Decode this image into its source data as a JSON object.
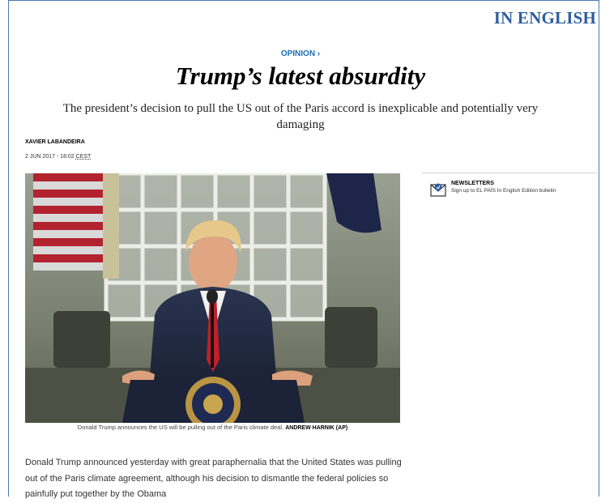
{
  "header": {
    "edition_label": "IN ENGLISH"
  },
  "article": {
    "section": "OPINION ›",
    "headline": "Trump’s latest absurdity",
    "subheadline": "The president’s decision to pull the US out of the Paris accord is inexplicable and potentially very damaging",
    "author": "XAVIER LABANDEIRA",
    "date": "2 JUN 2017 - 18:02",
    "timezone": "CEST",
    "photo": {
      "caption": "Donald Trump announces the US will be pulling out of the Paris climate deal.",
      "credit": "ANDREW HARNIK (AP)"
    },
    "body": "Donald Trump announced yesterday with great paraphernalia that the United States was pulling out of the Paris climate agreement, although his decision to dismantle the federal policies so painfully put together by the Obama"
  },
  "sidebar": {
    "newsletter": {
      "icon": "envelope-icon",
      "title": "NEWSLETTERS",
      "subtitle": "Sign up to EL PAÍS In English Edition bulletin"
    }
  },
  "colors": {
    "brand_blue": "#2d5d9f",
    "link_blue": "#1a6fb5",
    "frame_blue": "#4a78b8"
  }
}
